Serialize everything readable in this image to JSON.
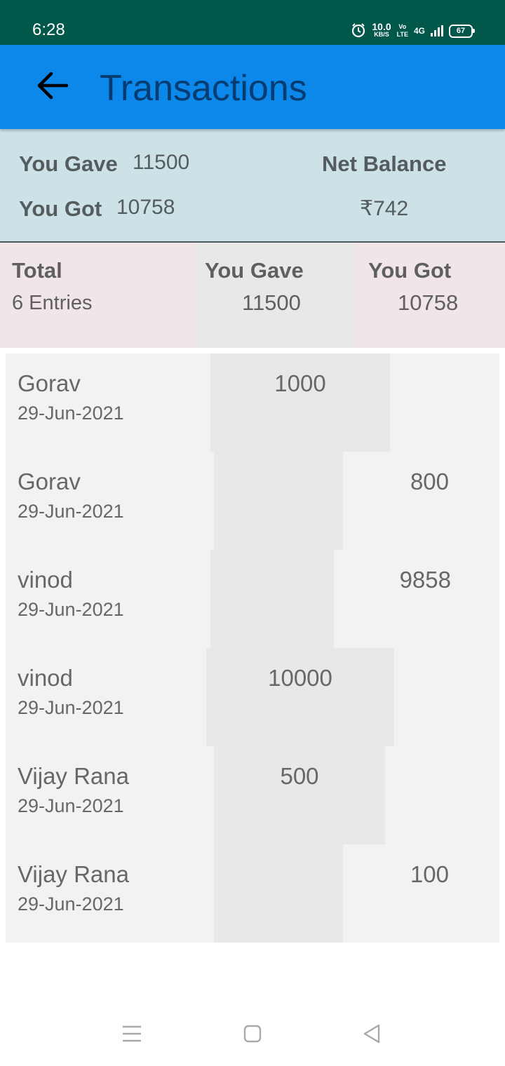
{
  "status_bar": {
    "time": "6:28",
    "net_speed_value": "10.0",
    "net_speed_unit": "KB/S",
    "volte_top": "Vo",
    "volte_bottom": "LTE",
    "network": "4G",
    "battery": "67"
  },
  "app_bar": {
    "title": "Transactions",
    "back_icon": "arrow-left-icon"
  },
  "summary": {
    "you_gave_label": "You Gave",
    "you_gave_value": "11500",
    "you_got_label": "You Got",
    "you_got_value": "10758",
    "net_balance_label": "Net Balance",
    "net_balance_value": "₹742"
  },
  "totals": {
    "total_label": "Total",
    "entries_text": "6 Entries",
    "you_gave_label": "You Gave",
    "you_gave_value": "11500",
    "you_got_label": "You Got",
    "you_got_value": "10758"
  },
  "transactions": [
    {
      "name": "Gorav",
      "date": "29-Jun-2021",
      "gave": "1000",
      "got": ""
    },
    {
      "name": "Gorav",
      "date": "29-Jun-2021",
      "gave": "",
      "got": "800"
    },
    {
      "name": "vinod",
      "date": "29-Jun-2021",
      "gave": "",
      "got": "9858"
    },
    {
      "name": "vinod",
      "date": "29-Jun-2021",
      "gave": "10000",
      "got": ""
    },
    {
      "name": "Vijay Rana",
      "date": "29-Jun-2021",
      "gave": "500",
      "got": ""
    },
    {
      "name": "Vijay Rana",
      "date": "29-Jun-2021",
      "gave": "",
      "got": "100"
    }
  ],
  "colors": {
    "status_bar": "#01574a",
    "app_bar": "#0b88e9",
    "title_text": "#053d72",
    "summary_bg": "#cce2e7",
    "totals_bg": "#f1e6e7",
    "cell_gray": "#e8e8e8",
    "row_bg": "#f2f2f2"
  },
  "nav": {
    "menu_icon": "menu-icon",
    "home_icon": "home-square-icon",
    "back_icon": "back-triangle-icon"
  }
}
